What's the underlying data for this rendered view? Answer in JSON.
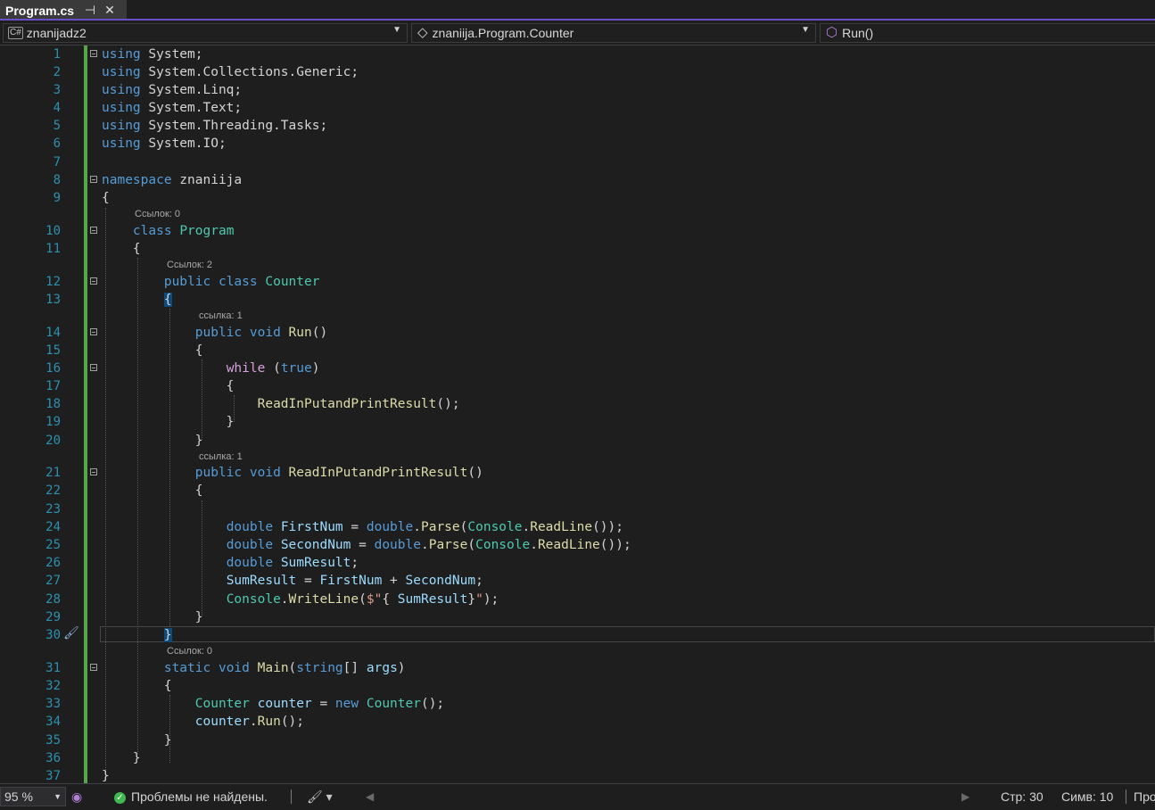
{
  "tab": {
    "title": "Program.cs",
    "pin_glyph": "⊣",
    "close_glyph": "✕"
  },
  "nav": {
    "project": "znanijadz2",
    "project_icon": "C#",
    "class_path": "znaniija.Program.Counter",
    "class_icon": "◇",
    "member": "Run()",
    "member_icon": "⬡"
  },
  "codelens": {
    "program": "Ссылок: 0",
    "counter": "Ссылок: 2",
    "run": "ссылка: 1",
    "readinput": "ссылка: 1",
    "main": "Ссылок: 0"
  },
  "line_numbers": [
    "1",
    "2",
    "3",
    "4",
    "5",
    "6",
    "7",
    "8",
    "9",
    "10",
    "11",
    "12",
    "13",
    "14",
    "15",
    "16",
    "17",
    "18",
    "19",
    "20",
    "21",
    "22",
    "23",
    "24",
    "25",
    "26",
    "27",
    "28",
    "29",
    "30",
    "31",
    "32",
    "33",
    "34",
    "35",
    "36",
    "37"
  ],
  "status": {
    "zoom": "95 %",
    "problems": "Проблемы не найдены.",
    "line": "Стр: 30",
    "col": "Симв: 10",
    "extra": "Про"
  },
  "colors": {
    "accent": "#6a4fc9",
    "linenumber": "#2b91af",
    "keyword": "#569cd6",
    "type": "#4ec9b0",
    "method": "#dcdcaa",
    "variable": "#9cdcfe",
    "control": "#d8a0df",
    "string": "#d69d85",
    "changebar": "#57a64a"
  }
}
